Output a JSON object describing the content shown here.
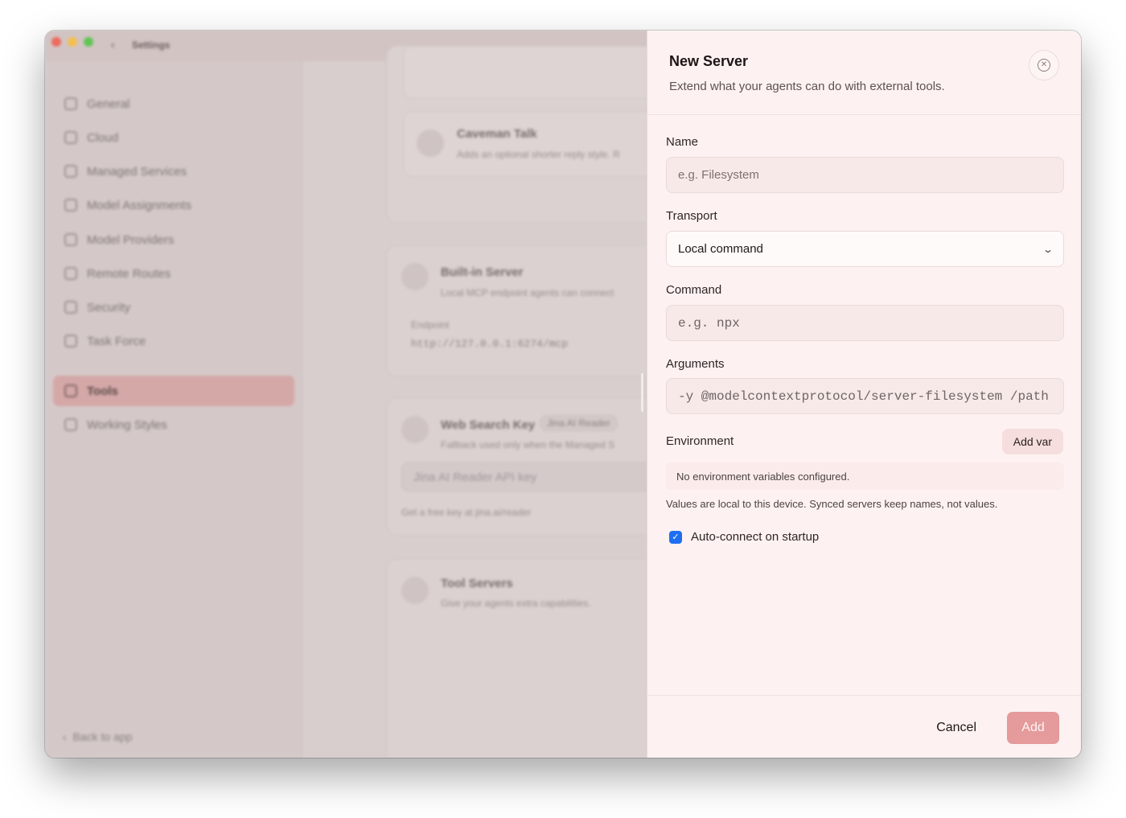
{
  "window": {
    "title": "Settings"
  },
  "sidebar": {
    "items": [
      {
        "label": "General",
        "icon": "home-icon"
      },
      {
        "label": "Cloud",
        "icon": "cloud-icon"
      },
      {
        "label": "Managed Services",
        "icon": "services-icon"
      },
      {
        "label": "Model Assignments",
        "icon": "assignments-icon"
      },
      {
        "label": "Model Providers",
        "icon": "providers-icon"
      },
      {
        "label": "Remote Routes",
        "icon": "routes-icon"
      },
      {
        "label": "Security",
        "icon": "shield-icon"
      },
      {
        "label": "Task Force",
        "icon": "taskforce-icon"
      },
      {
        "label": "Tools",
        "icon": "tools-icon",
        "active": true
      },
      {
        "label": "Working Styles",
        "icon": "styles-icon"
      }
    ],
    "back_label": "Back to app"
  },
  "main": {
    "caveman": {
      "title": "Caveman Talk",
      "subtitle": "Adds an optional shorter reply style. R"
    },
    "builtin": {
      "title": "Built-in Server",
      "subtitle": "Local MCP endpoint agents can connect",
      "endpoint_label": "Endpoint",
      "endpoint_value": "http://127.0.0.1:6274/mcp"
    },
    "websearch": {
      "title": "Web Search Key",
      "badge": "Jina AI Reader",
      "subtitle": "Fallback used only when the Managed S",
      "input_placeholder": "Jina AI Reader API key",
      "hint": "Get a free key at jina.ai/reader"
    },
    "toolservers": {
      "title": "Tool Servers",
      "subtitle": "Give your agents extra capabilities."
    }
  },
  "modal": {
    "title": "New Server",
    "subtitle": "Extend what your agents can do with external tools.",
    "name": {
      "label": "Name",
      "placeholder": "e.g. Filesystem"
    },
    "transport": {
      "label": "Transport",
      "value": "Local command"
    },
    "command": {
      "label": "Command",
      "placeholder": "e.g. npx"
    },
    "arguments": {
      "label": "Arguments",
      "placeholder": "-y @modelcontextprotocol/server-filesystem /path"
    },
    "environment": {
      "label": "Environment",
      "add_label": "Add var",
      "empty": "No environment variables configured.",
      "hint": "Values are local to this device. Synced servers keep names, not values."
    },
    "autoconnect": {
      "label": "Auto-connect on startup",
      "checked": true
    },
    "cancel_label": "Cancel",
    "add_label": "Add"
  }
}
